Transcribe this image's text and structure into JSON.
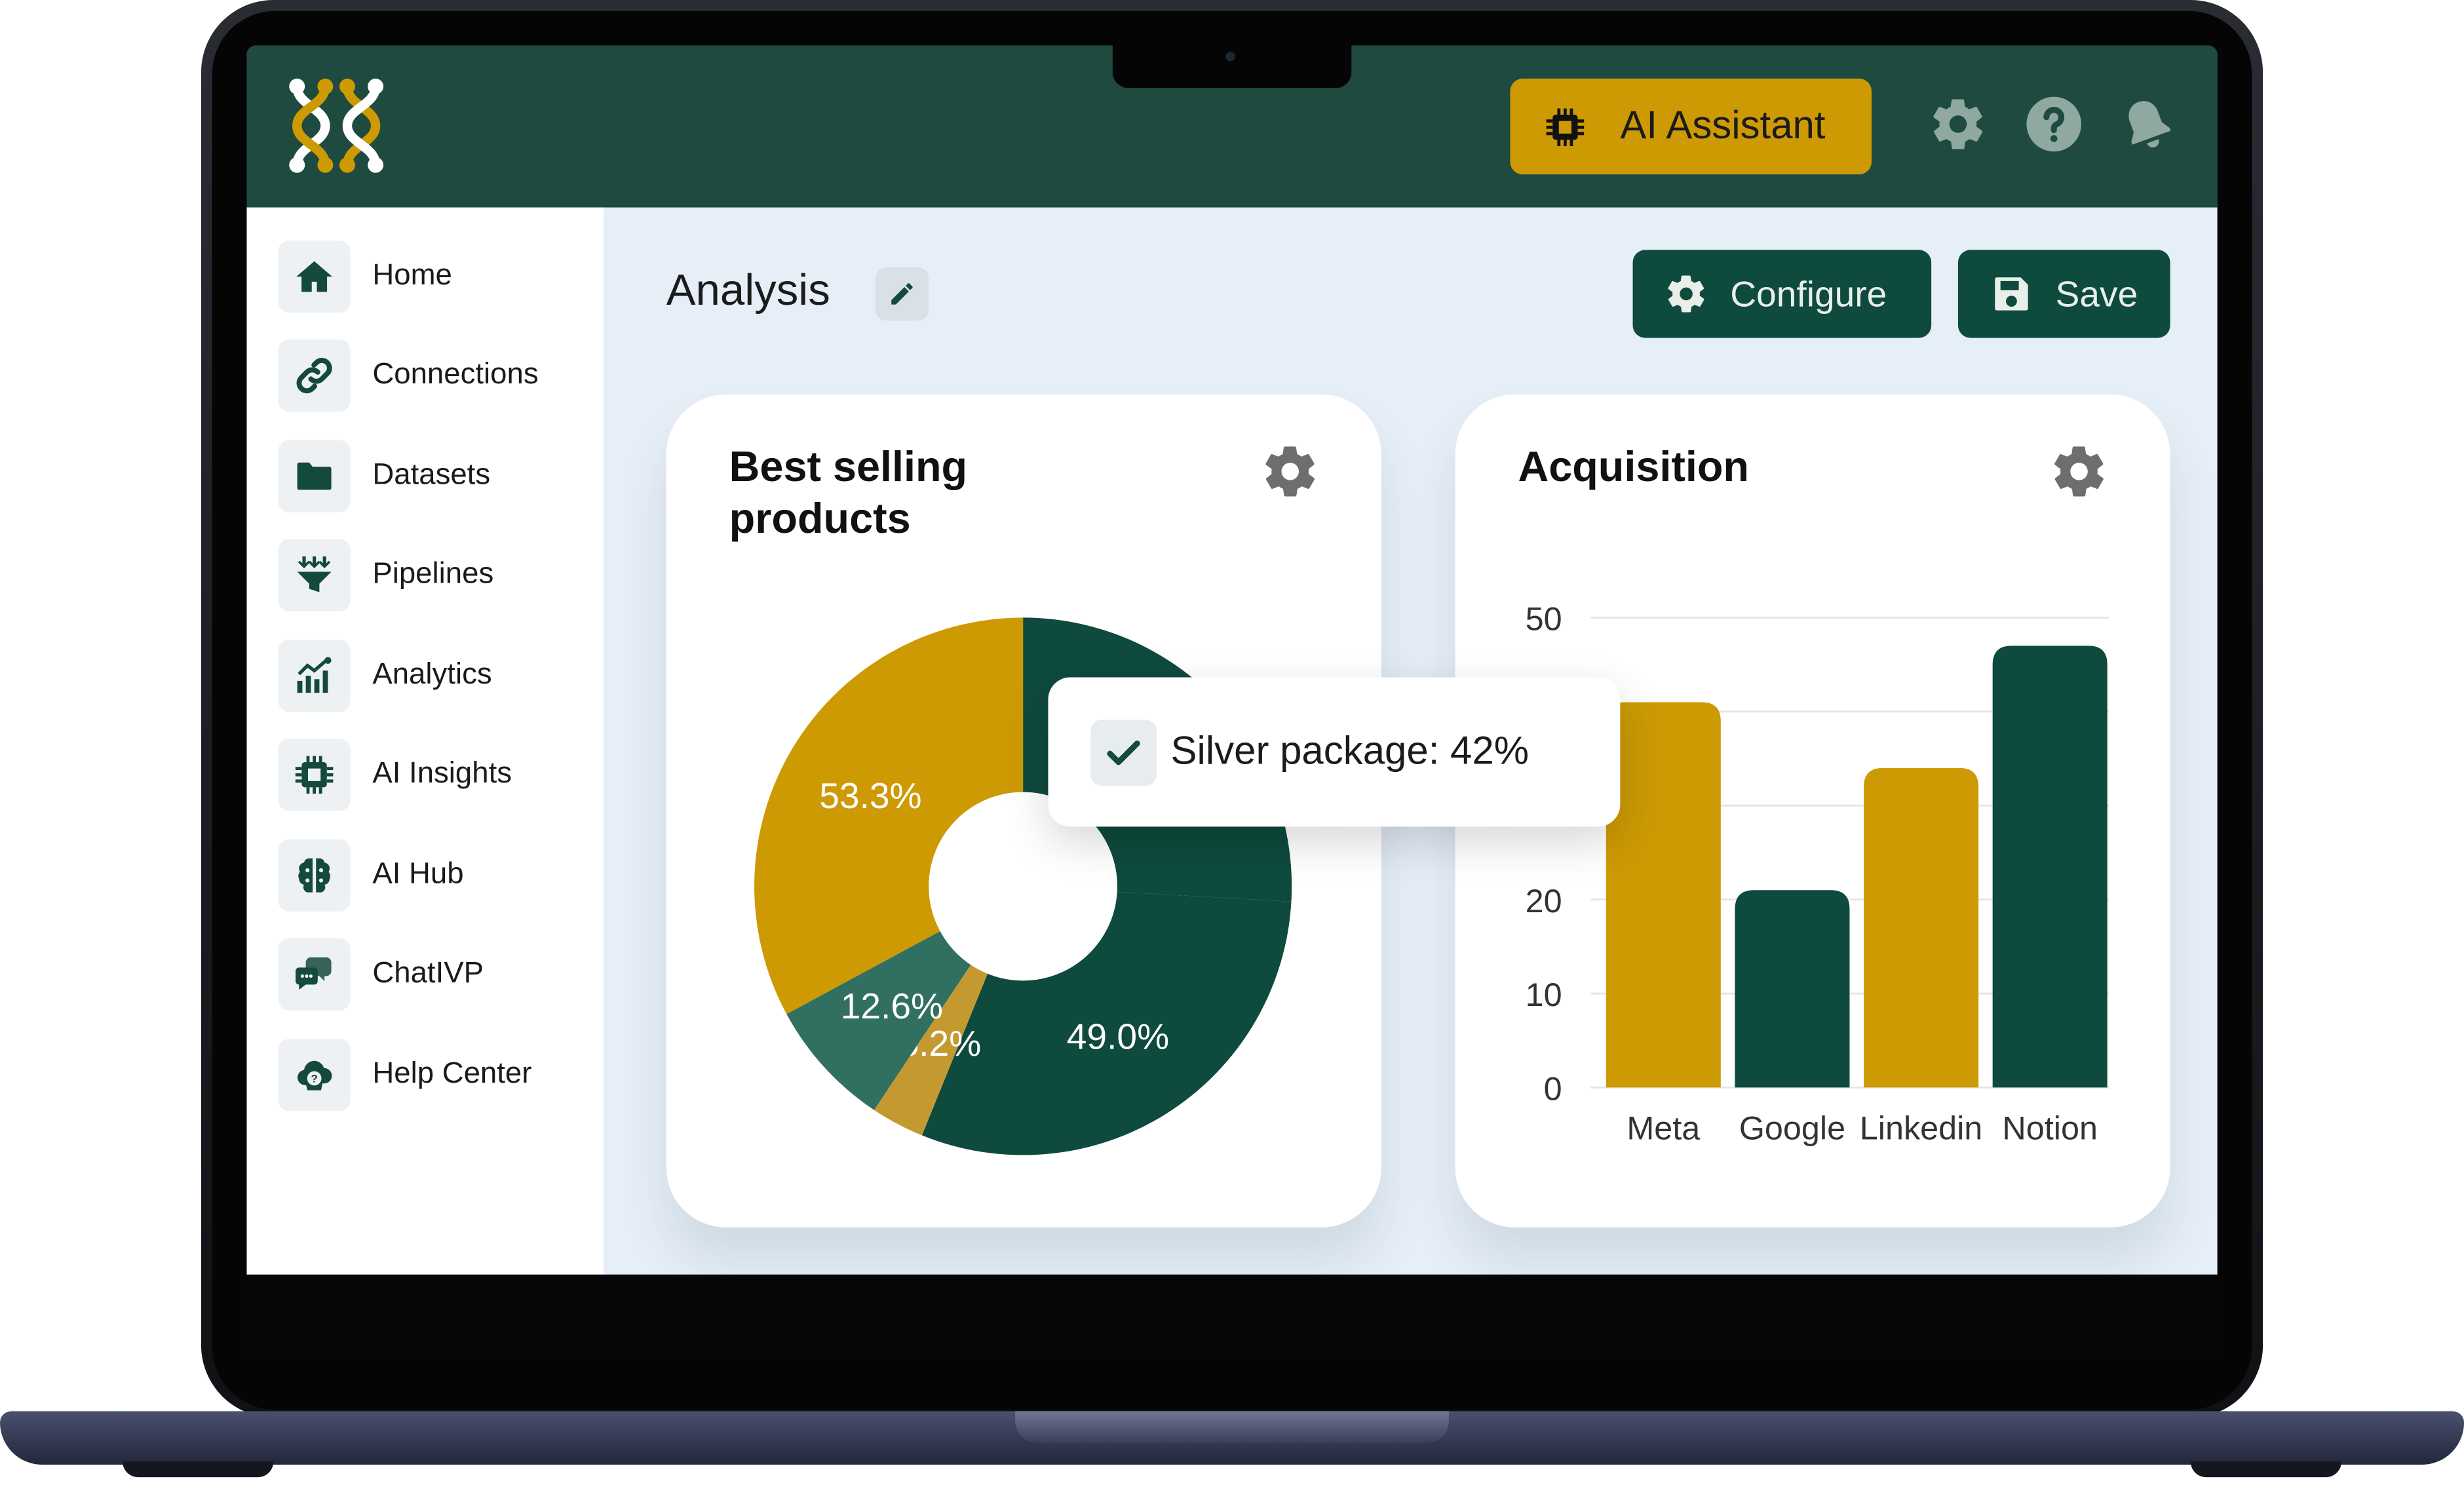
{
  "topbar": {
    "ai_assistant_label": "AI Assistant",
    "accent": "#cd9a04",
    "icons": [
      "gear-icon",
      "help-icon",
      "bell-icon"
    ]
  },
  "sidebar": {
    "items": [
      {
        "label": "Home",
        "icon": "home-icon"
      },
      {
        "label": "Connections",
        "icon": "link-icon"
      },
      {
        "label": "Datasets",
        "icon": "folder-icon"
      },
      {
        "label": "Pipelines",
        "icon": "funnel-icon"
      },
      {
        "label": "Analytics",
        "icon": "analytics-icon"
      },
      {
        "label": "AI Insights",
        "icon": "chip-icon"
      },
      {
        "label": "AI Hub",
        "icon": "brain-icon"
      },
      {
        "label": "ChatIVP",
        "icon": "chat-icon"
      },
      {
        "label": "Help Center",
        "icon": "help-cloud-icon"
      }
    ]
  },
  "main": {
    "title": "Analysis",
    "configure_label": "Configure",
    "save_label": "Save"
  },
  "colors": {
    "brand_green": "#0e4a3d",
    "gold": "#cd9a04",
    "light_gold": "#c49a30",
    "teal": "#317060"
  },
  "pie_card": {
    "title": "Best selling products",
    "tooltip": "Silver package: 42%"
  },
  "bar_card": {
    "title": "Acquisition"
  },
  "chart_data": [
    {
      "type": "pie",
      "title": "Best selling products",
      "donut": true,
      "slices": [
        {
          "label": "Silver package",
          "value": 42,
          "display": "",
          "color": "#0e4a3d"
        },
        {
          "label": "",
          "value": 49.0,
          "display": "49.0%",
          "color": "#0e4a3d"
        },
        {
          "label": "",
          "value": 5.2,
          "display": "5.2%",
          "color": "#c49a30"
        },
        {
          "label": "",
          "value": 12.6,
          "display": "12.6%",
          "color": "#317060"
        },
        {
          "label": "",
          "value": 53.3,
          "display": "53.3%",
          "color": "#cd9a04"
        }
      ]
    },
    {
      "type": "bar",
      "title": "Acquisition",
      "categories": [
        "Meta",
        "Google",
        "Linkedin",
        "Notion"
      ],
      "values": [
        41,
        21,
        34,
        47
      ],
      "colors": [
        "#cd9a04",
        "#0e4a3d",
        "#cd9a04",
        "#0e4a3d"
      ],
      "ylim": [
        0,
        50
      ],
      "yticks": [
        "0",
        "10",
        "20",
        "50"
      ],
      "grid": true
    }
  ]
}
